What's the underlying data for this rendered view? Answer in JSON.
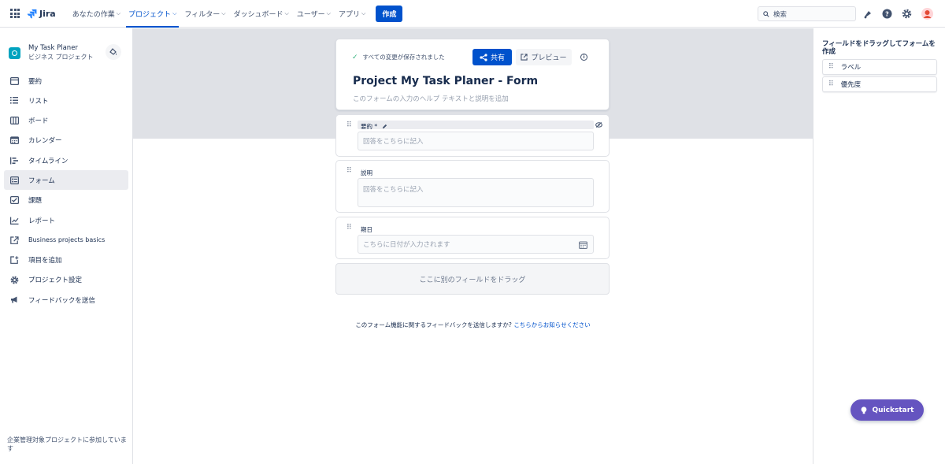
{
  "topnav": {
    "product": "Jira",
    "items": [
      {
        "label": "あなたの作業",
        "active": false
      },
      {
        "label": "プロジェクト",
        "active": true
      },
      {
        "label": "フィルター",
        "active": false
      },
      {
        "label": "ダッシュボード",
        "active": false
      },
      {
        "label": "ユーザー",
        "active": false
      },
      {
        "label": "アプリ",
        "active": false
      }
    ],
    "create_label": "作成",
    "search_placeholder": "検索",
    "icons": [
      "notifications-icon",
      "help-icon",
      "settings-icon",
      "avatar"
    ]
  },
  "sidebar": {
    "project_name": "My Task Planer",
    "project_type": "ビジネス プロジェクト",
    "items": [
      {
        "label": "要約",
        "icon": "summary-icon"
      },
      {
        "label": "リスト",
        "icon": "list-icon"
      },
      {
        "label": "ボード",
        "icon": "board-icon"
      },
      {
        "label": "カレンダー",
        "icon": "calendar-icon"
      },
      {
        "label": "タイムライン",
        "icon": "timeline-icon"
      },
      {
        "label": "フォーム",
        "icon": "form-icon"
      },
      {
        "label": "課題",
        "icon": "issues-icon"
      },
      {
        "label": "レポート",
        "icon": "reports-icon"
      },
      {
        "label": "Business projects basics",
        "icon": "external-link-icon"
      },
      {
        "label": "項目を追加",
        "icon": "add-item-icon"
      },
      {
        "label": "プロジェクト設定",
        "icon": "gear-icon"
      },
      {
        "label": "フィードバックを送信",
        "icon": "megaphone-icon"
      }
    ],
    "active_index": 5,
    "footer": "企業管理対象プロジェクトに参加しています"
  },
  "form": {
    "saved_status": "すべての変更が保存されました",
    "share_label": "共有",
    "preview_label": "プレビュー",
    "title": "Project My Task Planer - Form",
    "help_placeholder": "このフォームの入力のヘルプ テキストと説明を追加",
    "fields": [
      {
        "label": "要約 *",
        "placeholder": "回答をこちらに記入"
      },
      {
        "label": "説明",
        "placeholder": "回答をこちらに記入"
      },
      {
        "label": "期日",
        "placeholder": "こちらに日付が入力されます"
      }
    ],
    "drop_zone": "ここに別のフィールドをドラッグ",
    "feedback_text": "このフォーム機能に関するフィードバックを送信しますか? ",
    "feedback_link": "こちらからお知らせください"
  },
  "right_panel": {
    "title": "フィールドをドラッグしてフォームを作成",
    "fields": [
      "ラベル",
      "優先度"
    ]
  },
  "quickstart": {
    "label": "Quickstart"
  }
}
